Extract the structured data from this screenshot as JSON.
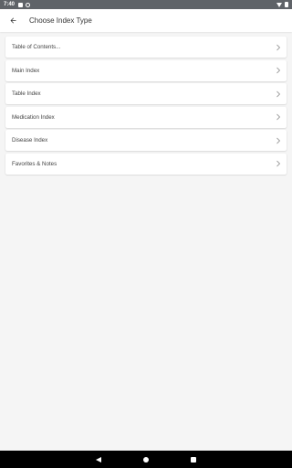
{
  "status_bar": {
    "time": "7:40",
    "left_icons": [
      "notification-square-icon",
      "notification-circle-icon"
    ],
    "right_icons": [
      "wifi-icon",
      "battery-icon"
    ]
  },
  "app_bar": {
    "back_icon": "arrow-left-icon",
    "title": "Choose Index Type"
  },
  "index_list": {
    "items": [
      {
        "label": "Table of Contents..."
      },
      {
        "label": "Main Index"
      },
      {
        "label": "Table Index"
      },
      {
        "label": "Medication Index"
      },
      {
        "label": "Disease Index"
      },
      {
        "label": "Favorites & Notes"
      }
    ],
    "chevron_icon": "chevron-right-icon"
  },
  "nav_bar": {
    "icons": [
      "nav-back-icon",
      "nav-home-icon",
      "nav-recents-icon"
    ]
  },
  "colors": {
    "background": "#f5f5f5",
    "status_bar": "#5f6368",
    "card": "#ffffff",
    "text": "#444444",
    "chevron": "#9e9e9e",
    "nav_bar": "#000000"
  }
}
